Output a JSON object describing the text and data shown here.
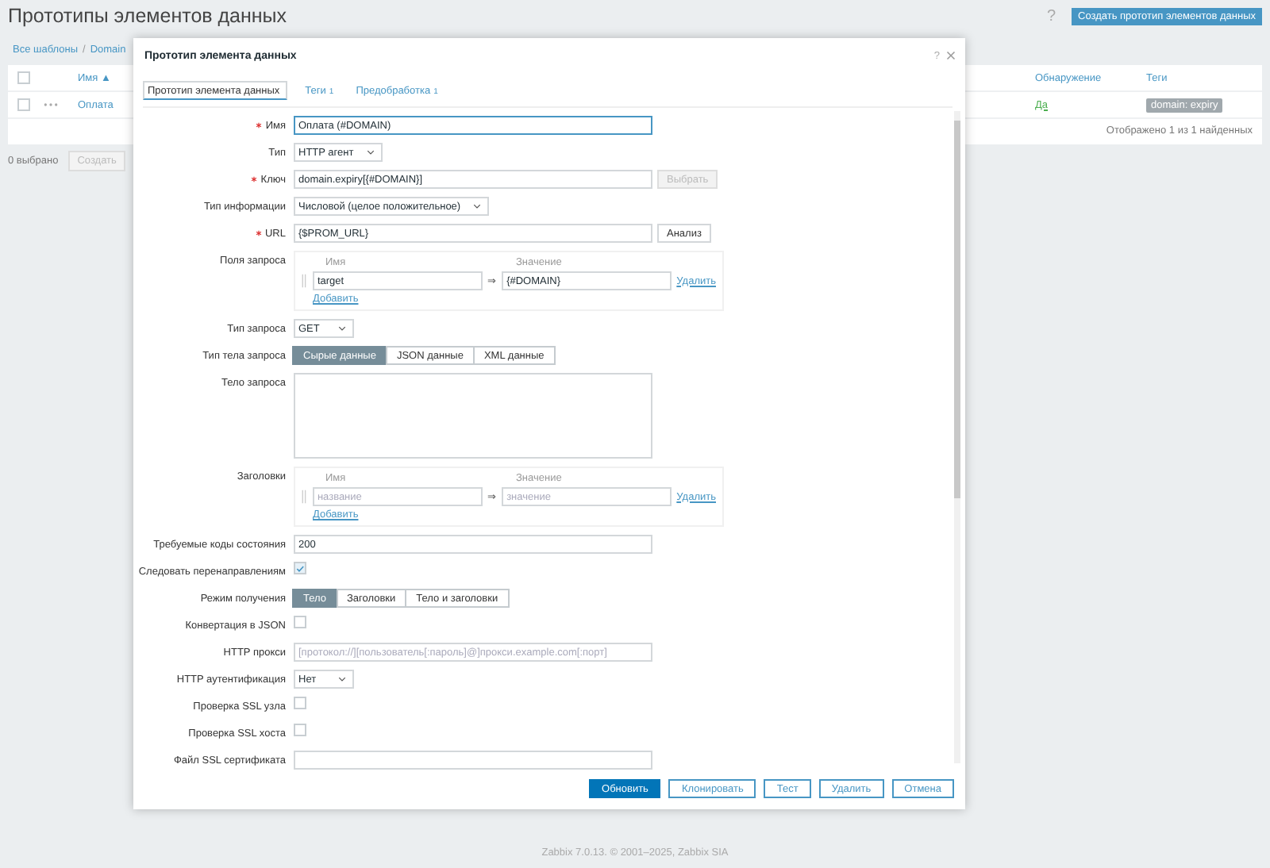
{
  "page": {
    "title": "Прототипы элементов данных",
    "help": "?",
    "create_button": "Создать прототип элементов данных"
  },
  "breadcrumbs": {
    "items": [
      "Все шаблоны",
      "Domain"
    ],
    "separator": "/"
  },
  "table": {
    "columns": [
      {
        "label": "Имя",
        "sort": "▲"
      },
      {
        "label": "Обнаружение"
      },
      {
        "label": "Теги"
      }
    ],
    "select_all": false,
    "rows": [
      {
        "checked": false,
        "name": "Оплата",
        "discovery": "Да",
        "tags": [
          "domain: expiry"
        ]
      }
    ],
    "summary": "Отображено 1 из 1 найденных"
  },
  "selection": {
    "count": "0 выбрано",
    "button": "Создать"
  },
  "footer": "Zabbix 7.0.13. © 2001–2025, Zabbix SIA",
  "dialog": {
    "title": "Прототип элемента данных",
    "help": "?",
    "tabs": [
      {
        "label": "Прототип элемента данных",
        "selected": true
      },
      {
        "label": "Теги",
        "count": "1",
        "selected": false
      },
      {
        "label": "Предобработка",
        "count": "1",
        "selected": false
      }
    ],
    "fields": [
      {
        "kind": "text",
        "label": "Имя",
        "required": true,
        "value": "Оплата (#DOMAIN)",
        "focused": true
      },
      {
        "kind": "select",
        "label": "Тип",
        "value": "HTTP агент"
      },
      {
        "kind": "text",
        "label": "Ключ",
        "required": true,
        "value": "domain.expiry[{#DOMAIN}]",
        "button": {
          "label": "Выбрать",
          "disabled": true
        }
      },
      {
        "kind": "select",
        "label": "Тип информации",
        "value": "Числовой (целое положительное)"
      },
      {
        "kind": "text",
        "label": "URL",
        "required": true,
        "value": "{$PROM_URL}",
        "button": {
          "label": "Анализ",
          "disabled": false
        }
      },
      {
        "kind": "pairs",
        "label": "Поля запроса",
        "name_header": "Имя",
        "value_header": "Значение",
        "arrow": "⇒",
        "rows": [
          {
            "name": "target",
            "value": "{#DOMAIN}",
            "remove": "Удалить"
          }
        ],
        "add": "Добавить"
      },
      {
        "kind": "select",
        "label": "Тип запроса",
        "value": "GET"
      },
      {
        "kind": "segmented",
        "label": "Тип тела запроса",
        "options": [
          {
            "label": "Сырые данные",
            "selected": true
          },
          {
            "label": "JSON данные",
            "selected": false
          },
          {
            "label": "XML данные",
            "selected": false
          }
        ]
      },
      {
        "kind": "textarea",
        "label": "Тело запроса"
      },
      {
        "kind": "pairs",
        "label": "Заголовки",
        "name_header": "Имя",
        "value_header": "Значение",
        "arrow": "⇒",
        "rows": [
          {
            "name_placeholder": "название",
            "value_placeholder": "значение",
            "remove": "Удалить"
          }
        ],
        "add": "Добавить"
      },
      {
        "kind": "text",
        "label": "Требуемые коды состояния",
        "value": "200"
      },
      {
        "kind": "checkbox",
        "label": "Следовать перенаправлениям",
        "checked": true
      },
      {
        "kind": "segmented",
        "label": "Режим получения",
        "options": [
          {
            "label": "Тело",
            "selected": true
          },
          {
            "label": "Заголовки",
            "selected": false
          },
          {
            "label": "Тело и заголовки",
            "selected": false
          }
        ]
      },
      {
        "kind": "checkbox",
        "label": "Конвертация в JSON",
        "checked": false
      },
      {
        "kind": "text",
        "label": "HTTP прокси",
        "placeholder": "[протокол://][пользователь[:пароль]@]прокси.example.com[:порт]"
      },
      {
        "kind": "select",
        "label": "HTTP аутентификация",
        "value": "Нет"
      },
      {
        "kind": "checkbox",
        "label": "Проверка SSL узла",
        "checked": false
      },
      {
        "kind": "checkbox",
        "label": "Проверка SSL хоста",
        "checked": false
      },
      {
        "kind": "text",
        "label": "Файл SSL сертификата"
      }
    ],
    "buttons": [
      {
        "label": "Обновить",
        "primary": true
      },
      {
        "label": "Клонировать",
        "primary": false
      },
      {
        "label": "Тест",
        "primary": false
      },
      {
        "label": "Удалить",
        "primary": false
      },
      {
        "label": "Отмена",
        "primary": false
      }
    ]
  }
}
